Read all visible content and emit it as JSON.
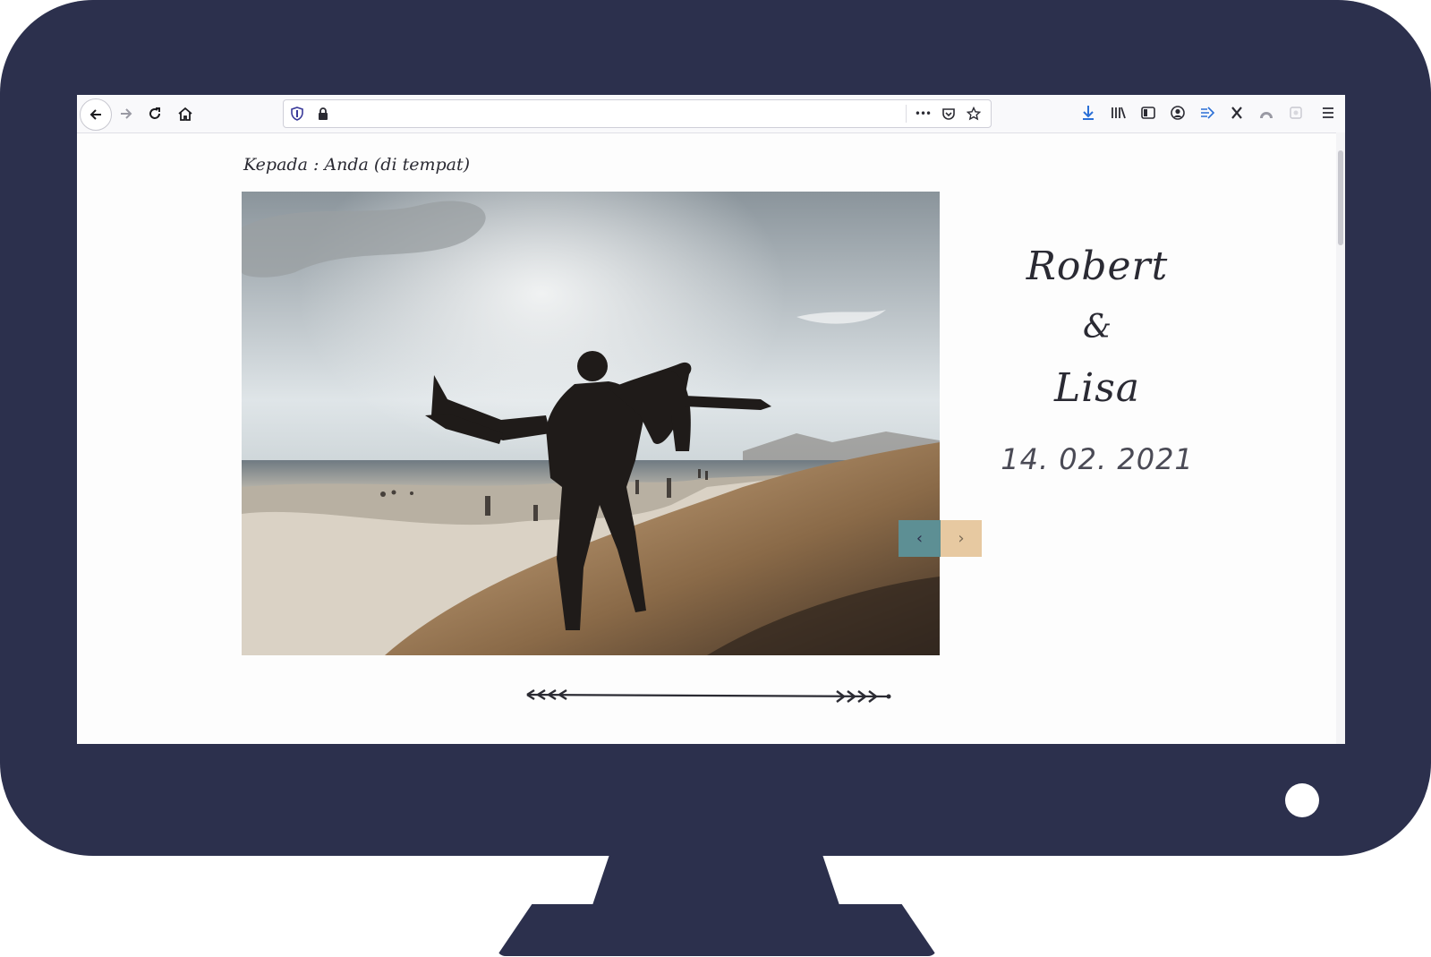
{
  "colors": {
    "bezel": "#2c304d",
    "prev_button": "#5d8f94",
    "next_button": "#e7c9a1"
  },
  "browser": {
    "toolbar_icons": [
      "back-arrow-icon",
      "forward-arrow-icon",
      "reload-icon",
      "home-icon",
      "shield-icon",
      "lock-icon",
      "more-icon",
      "pocket-icon",
      "star-icon",
      "download-icon",
      "library-icon",
      "sidebar-icon",
      "account-icon",
      "extension-arrow-icon",
      "x-icon",
      "shade-icon",
      "puzzle-icon",
      "menu-icon"
    ],
    "page_actions": {
      "more": "•••"
    }
  },
  "invitation": {
    "recipient": "Kepada : Anda (di tempat)",
    "groom": "Robert",
    "ampersand": "&",
    "bride": "Lisa",
    "date": "14. 02. 2021",
    "prev_label": "‹",
    "next_label": "›"
  }
}
